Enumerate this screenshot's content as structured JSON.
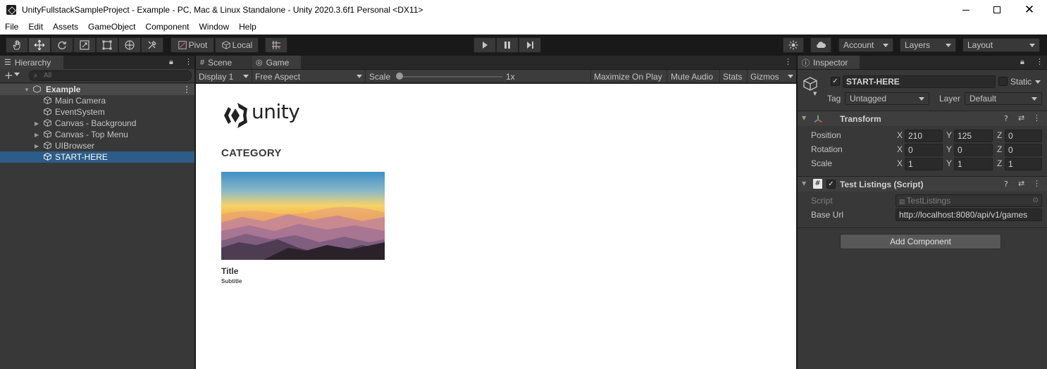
{
  "window": {
    "title": "UnityFullstackSampleProject - Example - PC, Mac & Linux Standalone - Unity 2020.3.6f1 Personal <DX11>"
  },
  "menu": [
    "File",
    "Edit",
    "Assets",
    "GameObject",
    "Component",
    "Window",
    "Help"
  ],
  "toolbar": {
    "pivot": "Pivot",
    "local": "Local",
    "account": "Account",
    "layers": "Layers",
    "layout": "Layout"
  },
  "hierarchy": {
    "tab": "Hierarchy",
    "search_placeholder": "All",
    "scene": "Example",
    "items": [
      {
        "label": "Main Camera",
        "foldable": false
      },
      {
        "label": "EventSystem",
        "foldable": false
      },
      {
        "label": "Canvas - Background",
        "foldable": true
      },
      {
        "label": "Canvas - Top Menu",
        "foldable": true
      },
      {
        "label": "UIBrowser",
        "foldable": true
      },
      {
        "label": "START-HERE",
        "foldable": false,
        "selected": true
      }
    ]
  },
  "scene_tab": "Scene",
  "game": {
    "tab": "Game",
    "display": "Display 1",
    "aspect": "Free Aspect",
    "scale_label": "Scale",
    "scale_value": "1x",
    "maximize": "Maximize On Play",
    "mute": "Mute Audio",
    "stats": "Stats",
    "gizmos": "Gizmos",
    "content": {
      "logo": "unity",
      "category": "CATEGORY",
      "card_title": "Title",
      "card_subtitle": "Subtitle"
    }
  },
  "inspector": {
    "tab": "Inspector",
    "object_name": "START-HERE",
    "static_label": "Static",
    "tag_label": "Tag",
    "tag_value": "Untagged",
    "layer_label": "Layer",
    "layer_value": "Default",
    "transform": {
      "title": "Transform",
      "position_label": "Position",
      "rotation_label": "Rotation",
      "scale_label": "Scale",
      "position": {
        "x": "210",
        "y": "125",
        "z": "0"
      },
      "rotation": {
        "x": "0",
        "y": "0",
        "z": "0"
      },
      "scale": {
        "x": "1",
        "y": "1",
        "z": "1"
      },
      "axis": {
        "x": "X",
        "y": "Y",
        "z": "Z"
      }
    },
    "script_component": {
      "title": "Test Listings (Script)",
      "script_label": "Script",
      "script_value": "TestListings",
      "base_url_label": "Base Url",
      "base_url_value": "http://localhost:8080/api/v1/games"
    },
    "add_component": "Add Component"
  },
  "colors": {
    "selection": "#2c5d87",
    "panel": "#383838",
    "toolbar": "#191919"
  }
}
